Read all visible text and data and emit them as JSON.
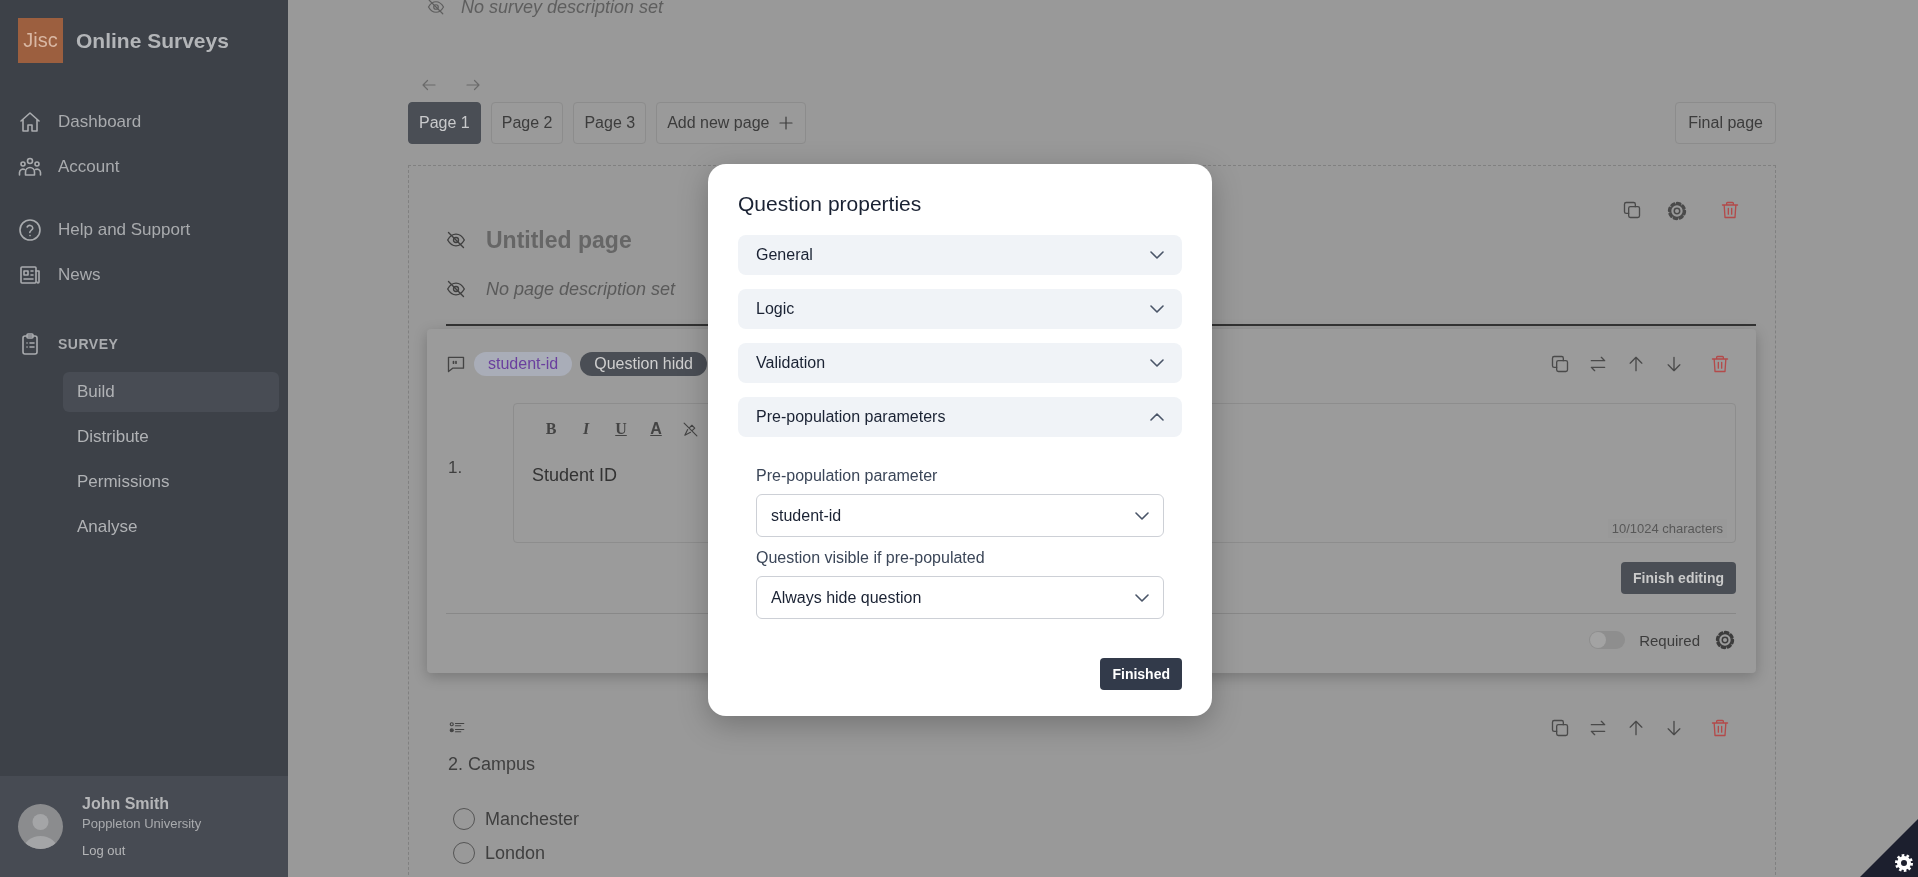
{
  "app": {
    "logo": "Jisc",
    "name": "Online Surveys"
  },
  "nav": [
    {
      "items": [
        {
          "label": "Dashboard"
        },
        {
          "label": "Account"
        }
      ]
    },
    {
      "items": [
        {
          "label": "Help and Support"
        },
        {
          "label": "News"
        }
      ]
    }
  ],
  "survey_section": {
    "heading": "SURVEY",
    "items": [
      {
        "label": "Build",
        "selected": true
      },
      {
        "label": "Distribute",
        "selected": false
      },
      {
        "label": "Permissions",
        "selected": false
      },
      {
        "label": "Analyse",
        "selected": false
      }
    ]
  },
  "user": {
    "name": "John Smith",
    "organisation": "Poppleton University",
    "logout": "Log out"
  },
  "survey_description": "No survey description set",
  "page_tabs": [
    {
      "label": "Page 1",
      "selected": true
    },
    {
      "label": "Page 2",
      "selected": false
    },
    {
      "label": "Page 3",
      "selected": false
    }
  ],
  "add_page": "Add new page",
  "final_page": "Final page",
  "page": {
    "title": "Untitled page",
    "description": "No page description set"
  },
  "questions": [
    {
      "kind": "text",
      "number": "1.",
      "tag": "student-id",
      "badge": "Question hidd",
      "toolbar": [
        "B",
        "I",
        "U",
        "A"
      ],
      "text": "Student ID",
      "char_count": "10/1024 characters",
      "finish": "Finish editing",
      "required_label": "Required",
      "required": false
    },
    {
      "kind": "choice",
      "title": "2. Campus",
      "options": [
        {
          "label": "Manchester",
          "selected": false
        },
        {
          "label": "London",
          "selected": false
        }
      ]
    }
  ],
  "modal": {
    "title": "Question properties",
    "sections": [
      {
        "label": "General",
        "expanded": false
      },
      {
        "label": "Logic",
        "expanded": false
      },
      {
        "label": "Validation",
        "expanded": false
      },
      {
        "label": "Pre-population parameters",
        "expanded": true,
        "fields": [
          {
            "label": "Pre-population parameter",
            "value": "student-id"
          },
          {
            "label": "Question visible if pre-populated",
            "value": "Always hide question"
          }
        ]
      }
    ],
    "button": "Finished"
  }
}
